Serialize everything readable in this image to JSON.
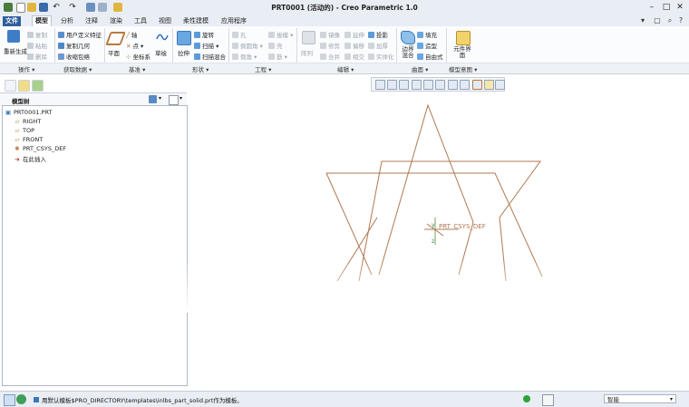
{
  "window": {
    "title": "PRT0001 (活动的) - Creo Parametric 1.0"
  },
  "tabs": [
    {
      "label": "文件"
    },
    {
      "label": "模型"
    },
    {
      "label": "分析"
    },
    {
      "label": "注释"
    },
    {
      "label": "渲染"
    },
    {
      "label": "工具"
    },
    {
      "label": "视图"
    },
    {
      "label": "柔性建模"
    },
    {
      "label": "应用程序"
    }
  ],
  "ribbon": {
    "operations": {
      "regenerate": "重新生成",
      "copy": "复制",
      "paste": "粘贴",
      "delete": "删除"
    },
    "get_data": {
      "udf": "用户定义特征",
      "copy_geom": "复制几何",
      "shrinkwrap": "收缩包络"
    },
    "datum": {
      "plane": "平面",
      "axis": "轴",
      "point": "点",
      "csys": "坐标系",
      "sketch": "草绘"
    },
    "shapes": {
      "extrude": "拉伸",
      "revolve": "旋转",
      "sweep": "扫描",
      "swept_blend": "扫描混合"
    },
    "engineering": {
      "hole": "孔",
      "round": "倒圆角",
      "chamfer": "倒角",
      "draft": "拔模",
      "shell": "壳",
      "rib": "筋"
    },
    "editing": {
      "pattern": "阵列",
      "mirror": "镜像",
      "merge": "合并",
      "trim": "修剪",
      "intersect": "相交",
      "extend": "延伸",
      "offset": "偏移",
      "project": "投影",
      "thicken": "加厚",
      "solidify": "实体化"
    },
    "surfaces": {
      "boundary_blend": "边界混合",
      "fill": "填充",
      "style": "造型",
      "freeform": "自由式"
    },
    "model_intent": {
      "component_interface": "元件界面"
    },
    "groups": [
      "操作",
      "获取数据",
      "基准",
      "形状",
      "工程",
      "编辑",
      "曲面",
      "模型意图"
    ]
  },
  "tree": {
    "header": "模型树",
    "items": [
      {
        "label": "PRT0001.PRT",
        "icon": "part-icon"
      },
      {
        "label": "RIGHT",
        "icon": "datum-plane-icon"
      },
      {
        "label": "TOP",
        "icon": "datum-plane-icon"
      },
      {
        "label": "FRONT",
        "icon": "datum-plane-icon"
      },
      {
        "label": "PRT_CSYS_DEF",
        "icon": "csys-icon"
      },
      {
        "label": "在此插入",
        "icon": "insert-arrow-icon"
      }
    ]
  },
  "canvas": {
    "csys_label": "PRT_CSYS_DEF",
    "geometry_color": "#b07850"
  },
  "status": {
    "message": "用默认模板$PRO_DIRECTORY\\templates\\inlbs_part_solid.prt作为模板。",
    "filter": "智能"
  },
  "colors": {
    "file_tab": "#2f5e9c",
    "titlebar": "#e9eef5"
  }
}
